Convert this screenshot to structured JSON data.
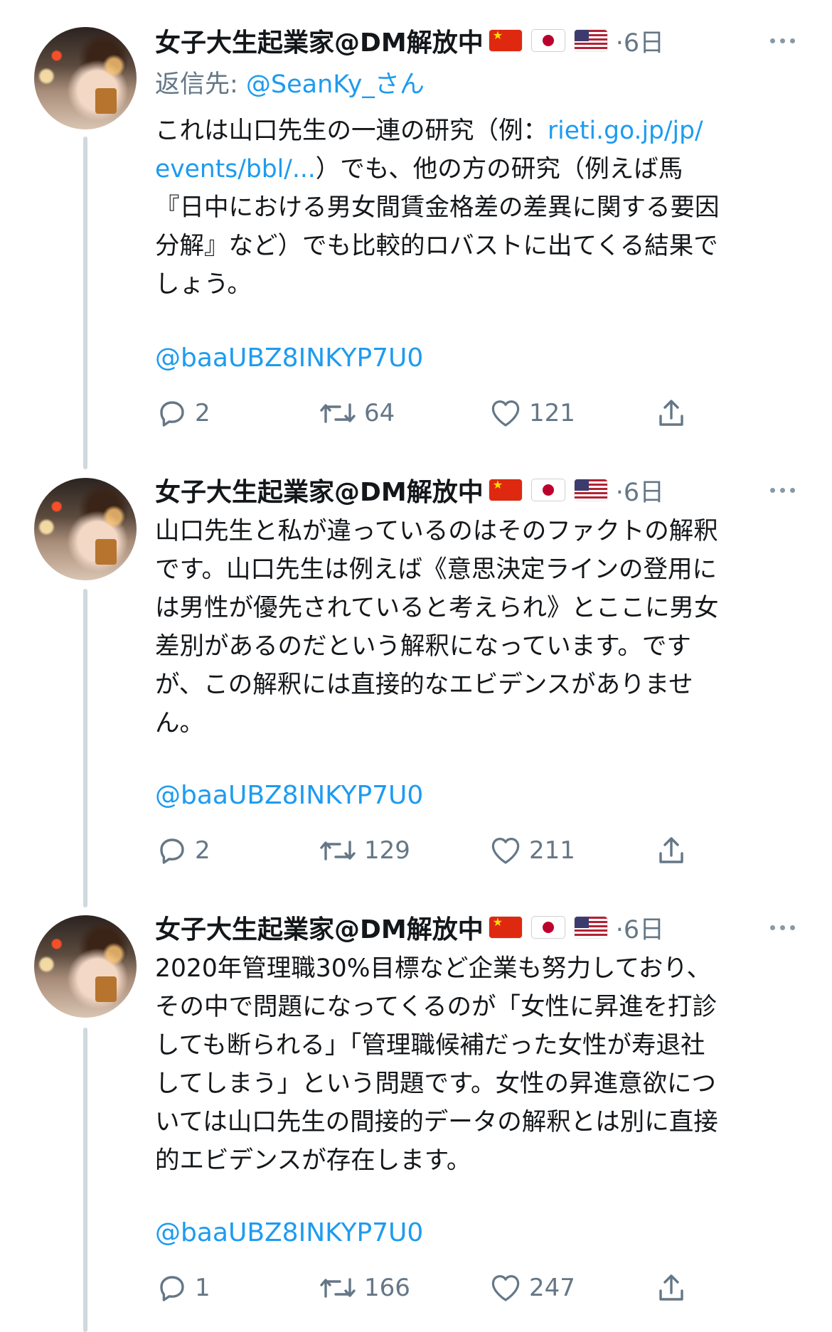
{
  "tweets": [
    {
      "author": "女子大生起業家@DM解放中",
      "flags": [
        "cn-flag-icon",
        "jp-flag-icon",
        "us-flag-icon"
      ],
      "time": "6日",
      "reply_prefix": "返信先: ",
      "reply_handle": "@SeanKy_さん",
      "text_before_link": "これは山口先生の一連の研究（例：",
      "link_text": "rieti.go.jp/jp/\nevents/bbl/...",
      "text_after_link": "）でも、他の方の研究（例えば馬\n『日中における男女間賃金格差の差異に関する要因\n分解』など）でも比較的ロバストに出てくる結果で\nしょう。",
      "mention": "@baaUBZ8INKYP7U0",
      "replies": "2",
      "retweets": "64",
      "likes": "121"
    },
    {
      "author": "女子大生起業家@DM解放中",
      "flags": [
        "cn-flag-icon",
        "jp-flag-icon",
        "us-flag-icon"
      ],
      "time": "6日",
      "text": "山口先生と私が違っているのはそのファクトの解釈\nです。山口先生は例えば《意思決定ラインの登用に\nは男性が優先されていると考えられ》とここに男女\n差別があるのだという解釈になっています。です\nが、この解釈には直接的なエビデンスがありませ\nん。",
      "mention": "@baaUBZ8INKYP7U0",
      "replies": "2",
      "retweets": "129",
      "likes": "211"
    },
    {
      "author": "女子大生起業家@DM解放中",
      "flags": [
        "cn-flag-icon",
        "jp-flag-icon",
        "us-flag-icon"
      ],
      "time": "6日",
      "text": "2020年管理職30%目標など企業も努力しており、\nその中で問題になってくるのが「女性に昇進を打診\nしても断られる」「管理職候補だった女性が寿退社\nしてしまう」という問題です。女性の昇進意欲につ\nいては山口先生の間接的データの解釈とは別に直接\n的エビデンスが存在します。",
      "mention": "@baaUBZ8INKYP7U0",
      "replies": "1",
      "retweets": "166",
      "likes": "247"
    }
  ],
  "separator_dot": "·",
  "colors": {
    "link": "#1d9bf0",
    "muted": "#657786",
    "thread_line": "#cfd9de"
  }
}
